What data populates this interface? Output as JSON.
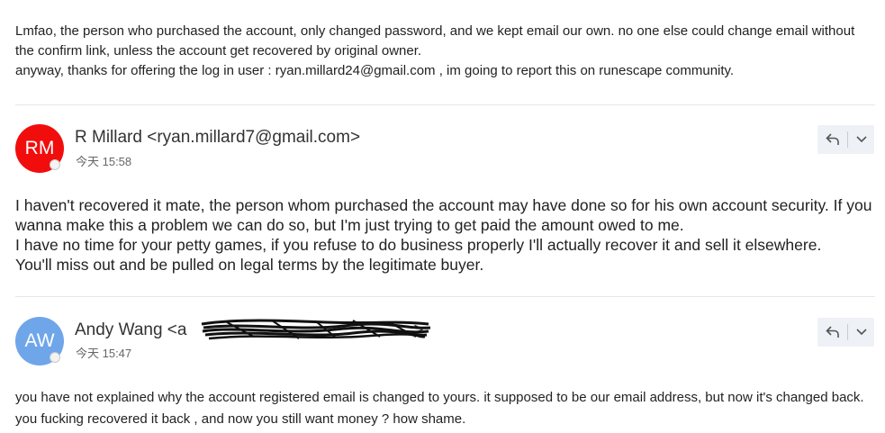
{
  "quoted_message": {
    "line1": "Lmfao, the person who purchased the account, only changed password, and we kept email our own. no one else could change email without the confirm link, unless the account get recovered by original owner.",
    "line2": "anyway, thanks for offering the log in user : ryan.millard24@gmail.com , im going to report this on runescape community."
  },
  "messages": [
    {
      "avatar_initials": "RM",
      "avatar_color": "#f20d0d",
      "sender": "R Millard <ryan.millard7@gmail.com>",
      "time": "今天 15:58",
      "body": "I haven't recovered it mate, the person whom purchased the account may have done so for his own account security. If you wanna make this a problem we can do so,  but I'm just trying to get paid the amount owed to me.\nI have no time for your petty games, if you refuse to do business properly I'll actually recover it and sell it elsewhere.\nYou'll miss out and be pulled on legal terms by the legitimate buyer."
    },
    {
      "avatar_initials": "AW",
      "avatar_color": "#6fa6ea",
      "sender_name": "Andy Wang",
      "sender_prefix": "<a",
      "sender_suffix": ">",
      "time": "今天 15:47",
      "body": "you have not explained why the account registered email is changed to yours. it supposed to be our email address, but now it's changed back. you fucking recovered it back , and now you still want money ? how shame."
    }
  ],
  "icons": {
    "reply": "reply-icon",
    "more": "chevron-down-icon",
    "redaction": "scribble-redaction"
  }
}
